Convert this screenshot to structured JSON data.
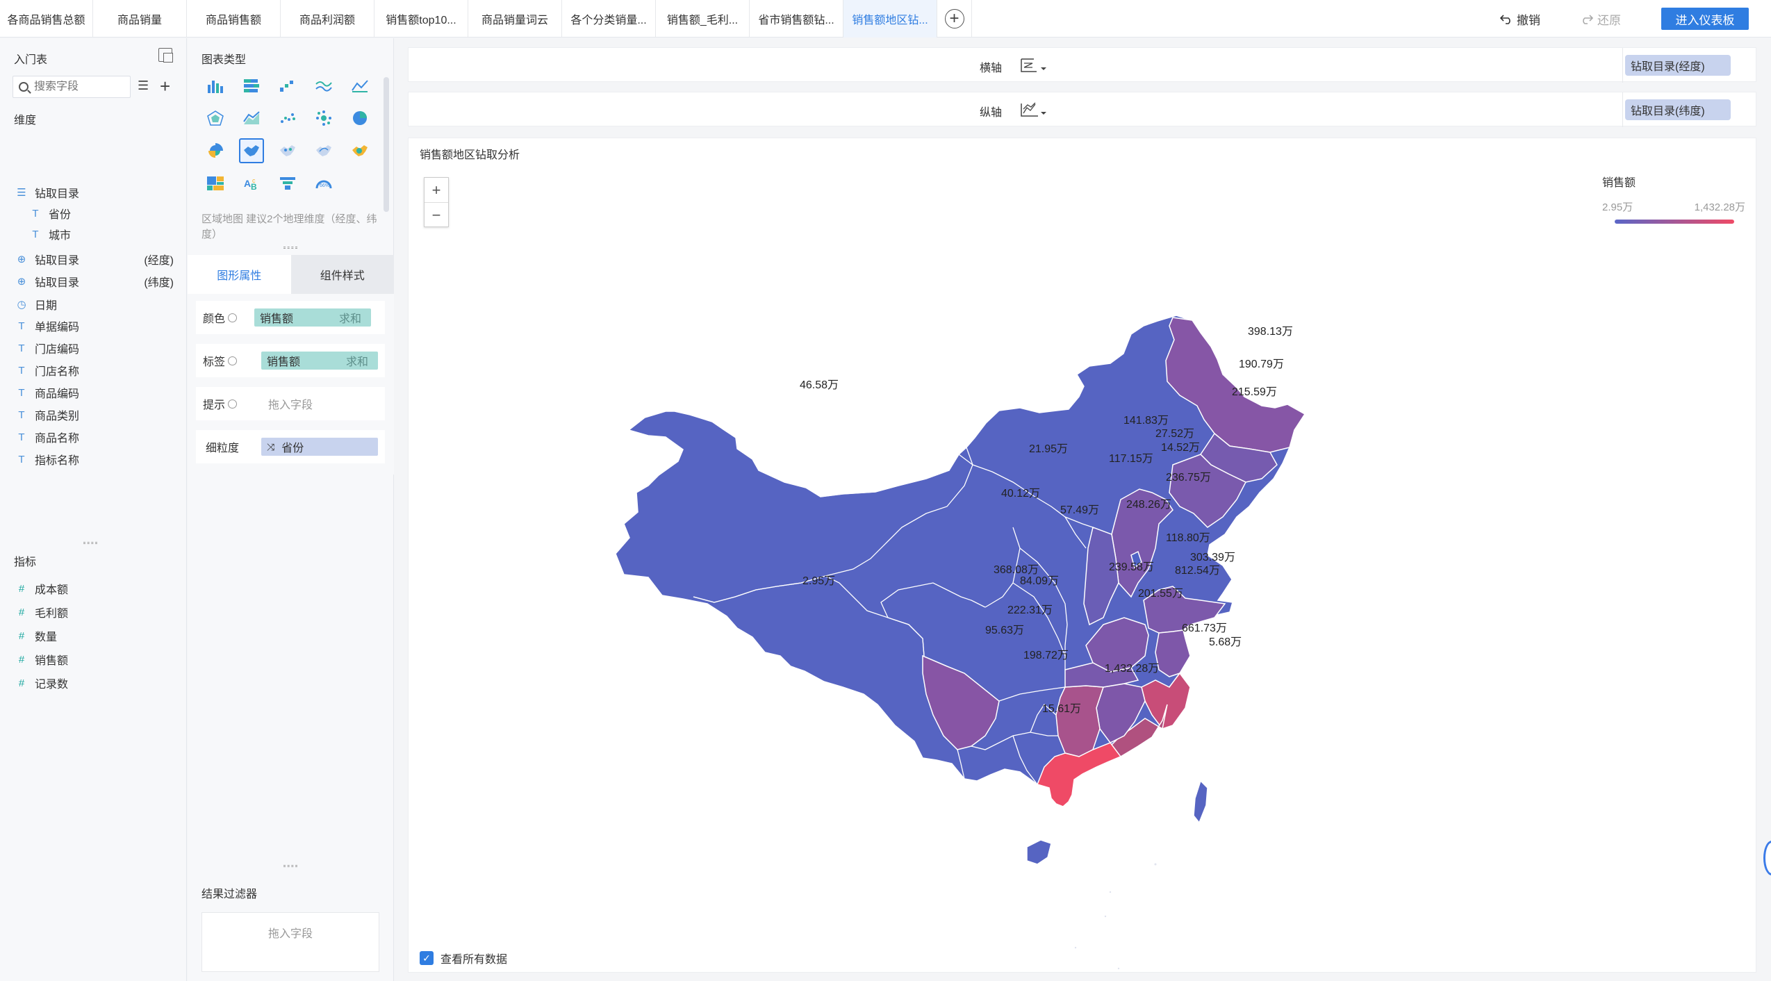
{
  "tabs": [
    {
      "label": "各商品销售总额",
      "active": false
    },
    {
      "label": "商品销量",
      "active": false
    },
    {
      "label": "商品销售额",
      "active": false
    },
    {
      "label": "商品利润额",
      "active": false
    },
    {
      "label": "销售额top10...",
      "active": false
    },
    {
      "label": "商品销量词云",
      "active": false
    },
    {
      "label": "各个分类销量...",
      "active": false
    },
    {
      "label": "销售额_毛利...",
      "active": false
    },
    {
      "label": "省市销售额钻...",
      "active": false
    },
    {
      "label": "销售额地区钻...",
      "active": true
    }
  ],
  "toolbar": {
    "undo": "撤销",
    "redo": "还原",
    "enter_dashboard": "进入仪表板"
  },
  "left": {
    "title": "入门表",
    "search_placeholder": "搜索字段",
    "dimension_label": "维度",
    "dimensions": [
      {
        "label": "钻取目录",
        "icon": "tree-icon",
        "suffix": ""
      },
      {
        "label": "省份",
        "icon": "text-icon",
        "suffix": ""
      },
      {
        "label": "城市",
        "icon": "text-icon",
        "suffix": ""
      },
      {
        "label": "钻取目录",
        "icon": "globe-icon",
        "suffix": "(经度)"
      },
      {
        "label": "钻取目录",
        "icon": "globe-icon",
        "suffix": "(纬度)"
      },
      {
        "label": "日期",
        "icon": "clock-icon",
        "suffix": ""
      },
      {
        "label": "单据编码",
        "icon": "text-icon",
        "suffix": ""
      },
      {
        "label": "门店编码",
        "icon": "text-icon",
        "suffix": ""
      },
      {
        "label": "门店名称",
        "icon": "text-icon",
        "suffix": ""
      },
      {
        "label": "商品编码",
        "icon": "text-icon",
        "suffix": ""
      },
      {
        "label": "商品类别",
        "icon": "text-icon",
        "suffix": ""
      },
      {
        "label": "商品名称",
        "icon": "text-icon",
        "suffix": ""
      },
      {
        "label": "指标名称",
        "icon": "text-icon",
        "suffix": ""
      }
    ],
    "measure_label": "指标",
    "measures": [
      {
        "label": "成本额",
        "icon": "hash-icon"
      },
      {
        "label": "毛利额",
        "icon": "hash-icon"
      },
      {
        "label": "数量",
        "icon": "hash-icon"
      },
      {
        "label": "销售额",
        "icon": "hash-icon"
      },
      {
        "label": "记录数",
        "icon": "hash-icon"
      }
    ]
  },
  "middle": {
    "chart_type_title": "图表类型",
    "chart_type_desc": "区域地图 建议2个地理维度（经度、纬度）",
    "tabs": {
      "graph_props": "图形属性",
      "component_style": "组件样式"
    },
    "props": {
      "color_label": "颜色",
      "color_field": "销售额",
      "color_agg": "求和",
      "label_label": "标签",
      "label_field": "销售额",
      "label_agg": "求和",
      "tooltip_label": "提示",
      "tooltip_placeholder": "拖入字段",
      "granularity_label": "细粒度",
      "granularity_field": "省份"
    },
    "filter_title": "结果过滤器",
    "filter_placeholder": "拖入字段"
  },
  "axes": {
    "x_label": "横轴",
    "x_field": "钻取目录(经度)",
    "y_label": "纵轴",
    "y_field": "钻取目录(纬度)"
  },
  "map": {
    "title": "销售额地区钻取分析",
    "legend_title": "销售额",
    "legend_min": "2.95万",
    "legend_max": "1,432.28万",
    "color_low": "#5a66c7",
    "color_high": "#ef4a66",
    "view_all": "查看所有数据",
    "zoom_in": "+",
    "zoom_out": "−",
    "labels": [
      {
        "text": "46.58万",
        "value": 46.58
      },
      {
        "text": "398.13万",
        "value": 398.13
      },
      {
        "text": "190.79万",
        "value": 190.79
      },
      {
        "text": "215.59万",
        "value": 215.59
      },
      {
        "text": "141.83万",
        "value": 141.83
      },
      {
        "text": "27.52万",
        "value": 27.52
      },
      {
        "text": "14.52万",
        "value": 14.52
      },
      {
        "text": "21.95万",
        "value": 21.95
      },
      {
        "text": "117.15万",
        "value": 117.15
      },
      {
        "text": "236.75万",
        "value": 236.75
      },
      {
        "text": "40.12万",
        "value": 40.12
      },
      {
        "text": "57.49万",
        "value": 57.49
      },
      {
        "text": "248.26万",
        "value": 248.26
      },
      {
        "text": "118.80万",
        "value": 118.8
      },
      {
        "text": "303.39万",
        "value": 303.39
      },
      {
        "text": "812.54万",
        "value": 812.54
      },
      {
        "text": "2.95万",
        "value": 2.95
      },
      {
        "text": "368.08万",
        "value": 368.08
      },
      {
        "text": "239.58万",
        "value": 239.58
      },
      {
        "text": "84.09万",
        "value": 84.09
      },
      {
        "text": "201.55万",
        "value": 201.55
      },
      {
        "text": "222.31万",
        "value": 222.31
      },
      {
        "text": "661.73万",
        "value": 661.73
      },
      {
        "text": "95.63万",
        "value": 95.63
      },
      {
        "text": "5.68万",
        "value": 5.68
      },
      {
        "text": "198.72万",
        "value": 198.72
      },
      {
        "text": "1,432.28万",
        "value": 1432.28
      },
      {
        "text": "15.61万",
        "value": 15.61
      }
    ]
  }
}
